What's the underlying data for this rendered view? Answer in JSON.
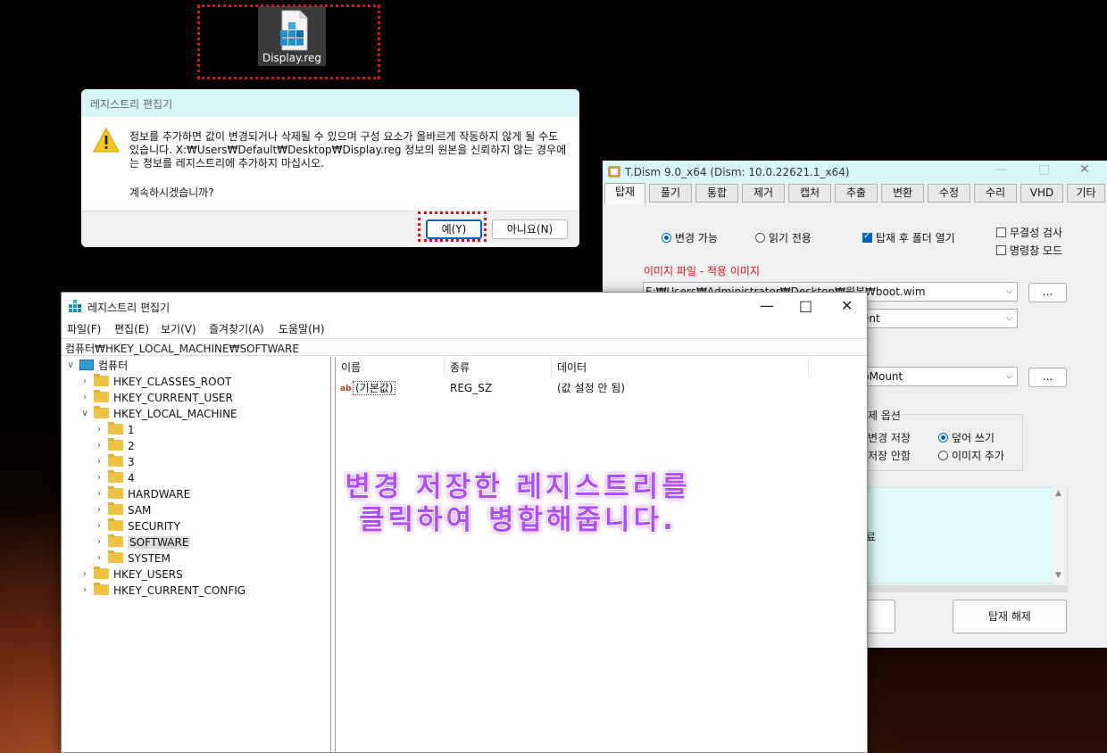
{
  "desktop": {
    "icon_label": "Display.reg"
  },
  "dialog": {
    "title": "레지스트리 편집기",
    "message": "정보를 추가하면 값이 변경되거나 삭제될 수 있으며 구성 요소가 올바르게 작동하지 않게 될 수도 있습니다. X:₩Users₩Default₩Desktop₩Display.reg 정보의 원본을 신뢰하지 않는 경우에는 정보를 레지스트리에 추가하지 마십시오.",
    "question": "계속하시겠습니까?",
    "yes_label": "예(Y)",
    "no_label": "아니요(N)"
  },
  "tdism": {
    "title": "T.Dism 9.0_x64  (Dism: 10.0.22621.1_x64)",
    "tabs": [
      "탑재",
      "풀기",
      "통합",
      "제거",
      "캡처",
      "추출",
      "변환",
      "수정",
      "수리",
      "VHD",
      "기타"
    ],
    "radio_rw": "변경 가능",
    "radio_ro": "읽기 전용",
    "chk_open_folder": "탑재 후 폴더 열기",
    "chk_integrity": "무결성 검사",
    "chk_cmd_mode": "명령창 모드",
    "image_file_label": "이미지 파일 - 적용 이미지",
    "image_path": "E:₩Users₩Administrator₩Desktop₩원본₩boot.wim",
    "combo2_text": "ent",
    "combo3_text": "pMount",
    "browse": "...",
    "unmount_options_label": "제 옵션",
    "opt_save_changes": "변경 저장",
    "opt_discard": "저장 안함",
    "opt_overwrite": "덮어 쓰기",
    "opt_append": "이미지 추가",
    "log_fragment": "료",
    "unmount_button": "탑재 해제"
  },
  "regedit": {
    "title": "레지스트리 편집기",
    "menu": [
      "파일(F)",
      "편집(E)",
      "보기(V)",
      "즐겨찾기(A)",
      "도움말(H)"
    ],
    "address": "컴퓨터₩HKEY_LOCAL_MACHINE₩SOFTWARE",
    "tree": {
      "root": "컴퓨터",
      "hkcr": "HKEY_CLASSES_ROOT",
      "hkcu": "HKEY_CURRENT_USER",
      "hklm": "HKEY_LOCAL_MACHINE",
      "hklm_children": [
        "1",
        "2",
        "3",
        "4",
        "HARDWARE",
        "SAM",
        "SECURITY",
        "SOFTWARE",
        "SYSTEM"
      ],
      "hku": "HKEY_USERS",
      "hkcc": "HKEY_CURRENT_CONFIG"
    },
    "columns": [
      "이름",
      "종류",
      "데이터"
    ],
    "rows": [
      {
        "name": "(기본값)",
        "type": "REG_SZ",
        "data": "(값 설정 안 됨)"
      }
    ]
  },
  "annotation": {
    "line1": "변경 저장한 레지스트리를",
    "line2": "클릭하여 병합해줍니다."
  },
  "colors": {
    "accent": "#0067c0",
    "highlight": "#d8141e",
    "annotation": "#b04dff",
    "title_tint": "#d8f7f9"
  }
}
